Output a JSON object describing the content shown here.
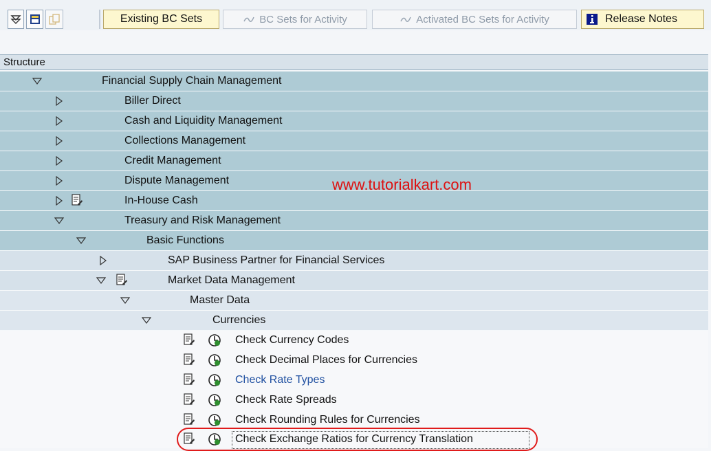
{
  "toolbar": {
    "existing_bc_sets": "Existing BC Sets",
    "bc_sets_for_activity": "BC Sets for Activity",
    "activated_bc_sets": "Activated BC Sets for Activity",
    "release_notes": "Release Notes"
  },
  "tree": {
    "header": "Structure",
    "items": [
      "Financial Supply Chain Management",
      "Biller Direct",
      "Cash and Liquidity Management",
      "Collections Management",
      "Credit Management",
      "Dispute Management",
      "In-House Cash",
      "Treasury and Risk Management",
      "Basic Functions",
      "SAP Business Partner for Financial Services",
      "Market Data Management",
      "Master Data",
      "Currencies",
      "Check Currency Codes",
      "Check Decimal Places for Currencies",
      "Check Rate Types",
      "Check Rate Spreads",
      "Check Rounding Rules for Currencies",
      "Check Exchange Ratios for Currency Translation"
    ]
  },
  "watermark": "www.tutorialkart.com",
  "colors": {
    "link": "#1f4fa0",
    "highlight": "#e01b1b"
  }
}
